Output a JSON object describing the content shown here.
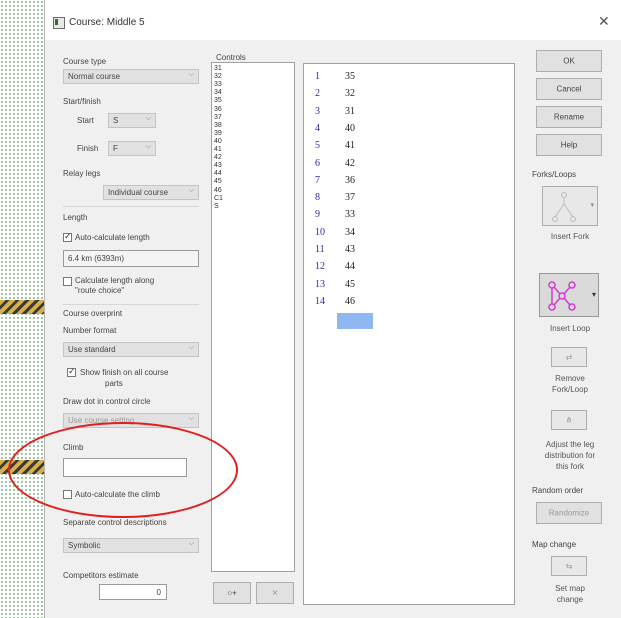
{
  "window": {
    "title": "Course: Middle 5",
    "close_glyph": "✕"
  },
  "left": {
    "course_type_label": "Course type",
    "course_type_value": "Normal course",
    "start_finish_label": "Start/finish",
    "start_label": "Start",
    "start_value": "S",
    "finish_label": "Finish",
    "finish_value": "F",
    "relay_legs_label": "Relay legs",
    "relay_legs_value": "Individual course",
    "length_label": "Length",
    "auto_length_label": "Auto-calculate length",
    "length_value": "6.4 km (6393m)",
    "route_choice_label_1": "Calculate length along",
    "route_choice_label_2": "\"route choice\"",
    "overprint_label": "Course overprint",
    "number_format_label": "Number format",
    "number_format_value": "Use standard",
    "show_finish_label_1": "Show finish on all course",
    "show_finish_label_2": "parts",
    "draw_dot_label": "Draw dot in control circle",
    "draw_dot_value": "Use course setting",
    "climb_label": "Climb",
    "climb_value": "",
    "auto_climb_label": "Auto-calculate the climb",
    "separate_desc_label": "Separate control descriptions",
    "separate_desc_value": "Symbolic",
    "competitors_label": "Competitors estimate",
    "competitors_value": "0"
  },
  "controls": {
    "label": "Controls",
    "list": [
      "31",
      "32",
      "33",
      "34",
      "35",
      "36",
      "37",
      "38",
      "39",
      "40",
      "41",
      "42",
      "43",
      "44",
      "45",
      "46",
      "C1",
      "S"
    ],
    "add_glyph": "○+",
    "remove_glyph": "✕"
  },
  "course_rows": [
    {
      "n": "1",
      "v": "35"
    },
    {
      "n": "2",
      "v": "32"
    },
    {
      "n": "3",
      "v": "31"
    },
    {
      "n": "4",
      "v": "40"
    },
    {
      "n": "5",
      "v": "41"
    },
    {
      "n": "6",
      "v": "42"
    },
    {
      "n": "7",
      "v": "36"
    },
    {
      "n": "8",
      "v": "37"
    },
    {
      "n": "9",
      "v": "33"
    },
    {
      "n": "10",
      "v": "34"
    },
    {
      "n": "11",
      "v": "43"
    },
    {
      "n": "12",
      "v": "44"
    },
    {
      "n": "13",
      "v": "45"
    },
    {
      "n": "14",
      "v": "46"
    }
  ],
  "right": {
    "ok": "OK",
    "cancel": "Cancel",
    "rename": "Rename",
    "help": "Help",
    "forks_loops_label": "Forks/Loops",
    "insert_fork": "Insert Fork",
    "insert_loop": "Insert Loop",
    "remove_fork_1": "Remove",
    "remove_fork_2": "Fork/Loop",
    "adjust_1": "Adjust the leg",
    "adjust_2": "distribution for",
    "adjust_3": "this fork",
    "random_order_label": "Random order",
    "randomize": "Randomize",
    "map_change_label": "Map change",
    "set_map_1": "Set map",
    "set_map_2": "change"
  },
  "colors": {
    "highlight": "#e02020",
    "selected_row": "#8fb8f0",
    "loop_icon": "#d23ad2"
  }
}
